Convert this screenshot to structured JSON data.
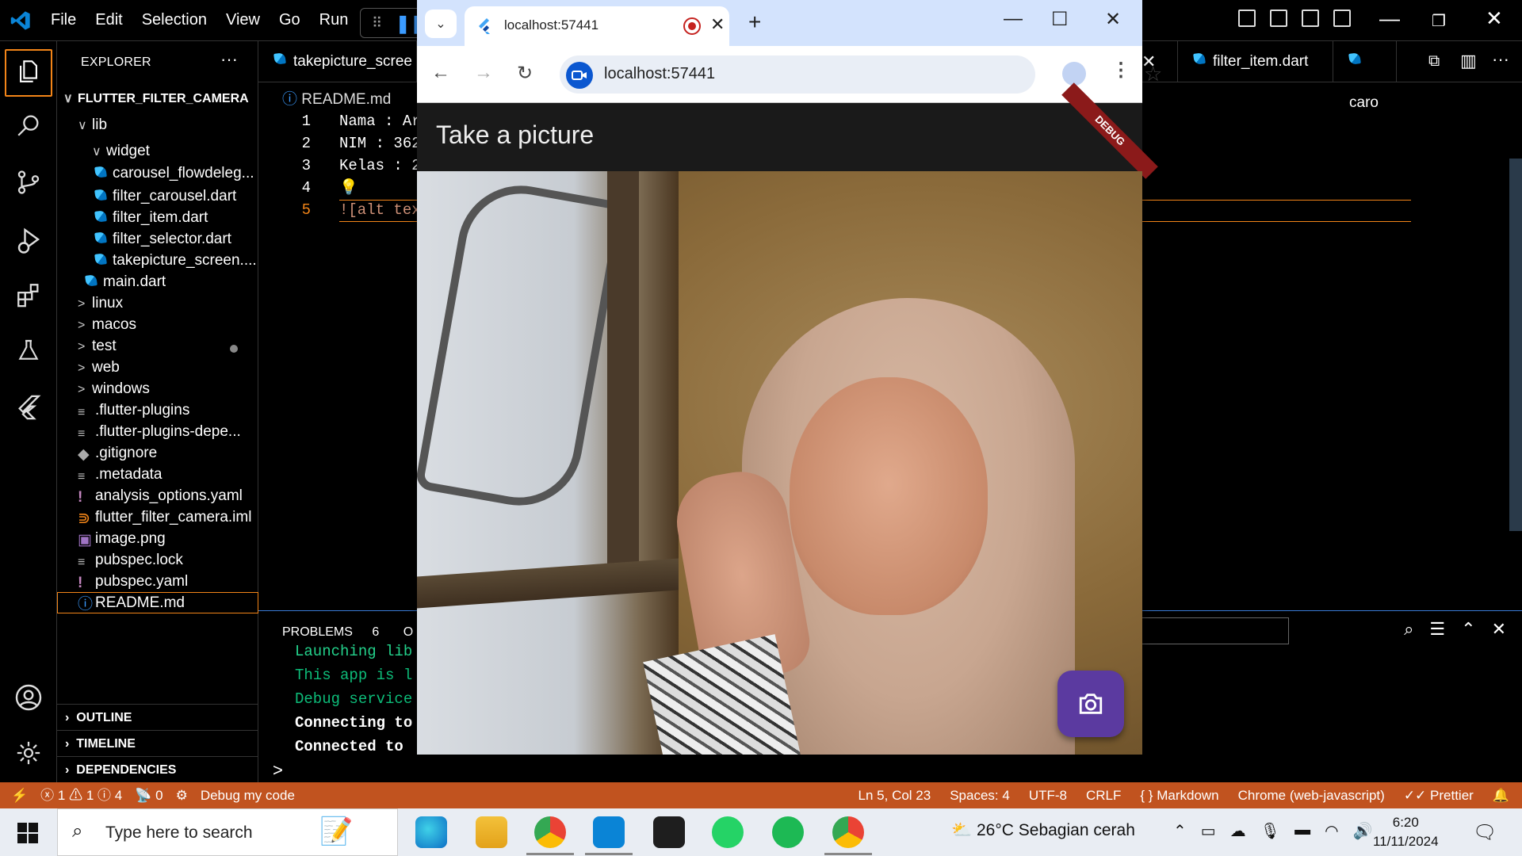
{
  "vscode": {
    "menu": [
      "File",
      "Edit",
      "Selection",
      "View",
      "Go",
      "Run"
    ],
    "explorer": {
      "title": "EXPLORER",
      "more": "···",
      "root": "FLUTTER_FILTER_CAMERA",
      "items": [
        {
          "label": "lib",
          "chevron": "∨"
        },
        {
          "label": "widget",
          "chevron": "∨"
        },
        {
          "label": "carousel_flowdeleg..."
        },
        {
          "label": "filter_carousel.dart"
        },
        {
          "label": "filter_item.dart"
        },
        {
          "label": "filter_selector.dart"
        },
        {
          "label": "takepicture_screen...."
        },
        {
          "label": "main.dart"
        },
        {
          "label": "linux",
          "chevron": ">"
        },
        {
          "label": "macos",
          "chevron": ">"
        },
        {
          "label": "test",
          "chevron": ">"
        },
        {
          "label": "web",
          "chevron": ">"
        },
        {
          "label": "windows",
          "chevron": ">"
        },
        {
          "label": ".flutter-plugins"
        },
        {
          "label": ".flutter-plugins-depe..."
        },
        {
          "label": ".gitignore"
        },
        {
          "label": ".metadata"
        },
        {
          "label": "analysis_options.yaml"
        },
        {
          "label": "flutter_filter_camera.iml"
        },
        {
          "label": "image.png"
        },
        {
          "label": "pubspec.lock"
        },
        {
          "label": "pubspec.yaml"
        },
        {
          "label": "README.md"
        }
      ],
      "sections": [
        "OUTLINE",
        "TIMELINE",
        "DEPENDENCIES"
      ]
    },
    "tabs": [
      "takepicture_scree",
      "filter_item.dart",
      "caro"
    ],
    "breadcrumb": "README.md",
    "code_lines": [
      {
        "num": "1",
        "text": "Nama : Ar"
      },
      {
        "num": "2",
        "text": "NIM : 362"
      },
      {
        "num": "3",
        "text": "Kelas : 2"
      },
      {
        "num": "4",
        "text": ""
      },
      {
        "num": "5",
        "text": "![alt tex"
      }
    ],
    "panel": {
      "problems_label": "PROBLEMS",
      "problems_count": "6",
      "next_tab": "O",
      "lines": [
        {
          "text": "Launching lib",
          "color": "#23d18b"
        },
        {
          "text": "This app is l",
          "color": "#0dbc79"
        },
        {
          "text": "Debug service",
          "color": "#0dbc79"
        },
        {
          "text": "Connecting to",
          "color": "#ffffff"
        },
        {
          "text": "Connected to ",
          "color": "#ffffff"
        }
      ],
      "prompt": ">"
    },
    "status": {
      "errors": "1",
      "warnings": "1",
      "info": "4",
      "ports": "0",
      "debug": "Debug my code",
      "position": "Ln 5, Col 23",
      "spaces": "Spaces: 4",
      "encoding": "UTF-8",
      "eol": "CRLF",
      "language": "Markdown",
      "target": "Chrome (web-javascript)",
      "prettier": "Prettier",
      "color": "#c1531f"
    }
  },
  "chrome": {
    "tab_title": "localhost:57441",
    "url": "localhost:57441",
    "app_title": "Take a picture",
    "debug_banner": "DEBUG",
    "fab_icon": "camera-icon"
  },
  "taskbar": {
    "search_placeholder": "Type here to search",
    "weather_temp": "26°C",
    "weather_desc": "Sebagian cerah",
    "time": "6:20",
    "date": "11/11/2024"
  }
}
